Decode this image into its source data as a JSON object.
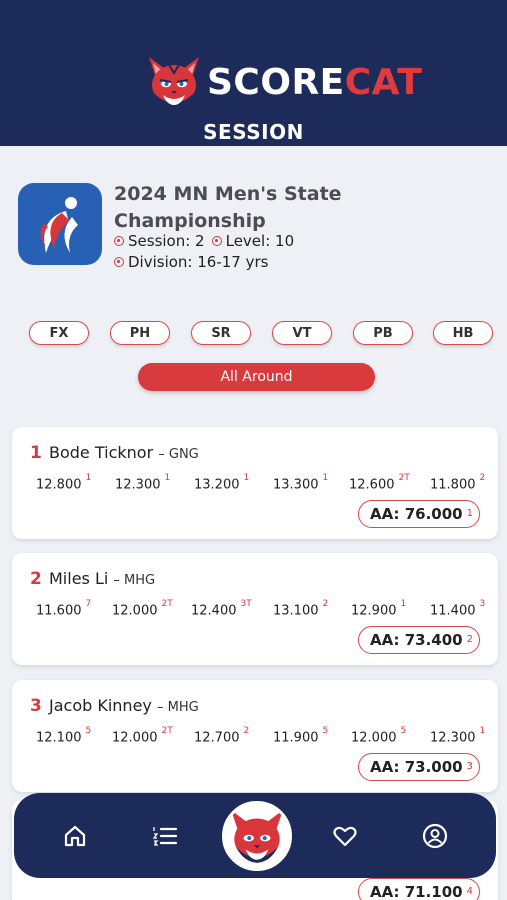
{
  "header": {
    "logo_text_white": "SCORE",
    "logo_text_red": "CAT",
    "title": "SESSION",
    "logo_icon": "cat-mascot-icon"
  },
  "meet": {
    "name": "2024 MN Men's State Championship",
    "session": "Session: 2",
    "level": "Level: 10",
    "division": "Division: 16-17 yrs",
    "logo_icon": "gymnastics-federation-logo"
  },
  "events": [
    "FX",
    "PH",
    "SR",
    "VT",
    "PB",
    "HB"
  ],
  "all_around_label": "All Around",
  "colors": {
    "navy": "#1d2b5a",
    "red": "#d93a3e",
    "background": "#eef0f5"
  },
  "results": [
    {
      "rank": "1",
      "name": "Bode Ticknor",
      "club": "– GNG",
      "scores": [
        {
          "score": "12.800",
          "place": "1"
        },
        {
          "score": "12.300",
          "place": "1"
        },
        {
          "score": "13.200",
          "place": "1"
        },
        {
          "score": "13.300",
          "place": "1"
        },
        {
          "score": "12.600",
          "place": "2T"
        },
        {
          "score": "11.800",
          "place": "2"
        }
      ],
      "aa": "AA: 76.000",
      "aa_place": "1"
    },
    {
      "rank": "2",
      "name": "Miles Li",
      "club": "– MHG",
      "scores": [
        {
          "score": "11.600",
          "place": "7"
        },
        {
          "score": "12.000",
          "place": "2T"
        },
        {
          "score": "12.400",
          "place": "3T"
        },
        {
          "score": "13.100",
          "place": "2"
        },
        {
          "score": "12.900",
          "place": "1"
        },
        {
          "score": "11.400",
          "place": "3"
        }
      ],
      "aa": "AA: 73.400",
      "aa_place": "2"
    },
    {
      "rank": "3",
      "name": "Jacob Kinney",
      "club": "– MHG",
      "scores": [
        {
          "score": "12.100",
          "place": "5"
        },
        {
          "score": "12.000",
          "place": "2T"
        },
        {
          "score": "12.700",
          "place": "2"
        },
        {
          "score": "11.900",
          "place": "5"
        },
        {
          "score": "12.000",
          "place": "5"
        },
        {
          "score": "12.300",
          "place": "1"
        }
      ],
      "aa": "AA: 73.000",
      "aa_place": "3"
    },
    {
      "aa": "AA: 71.100",
      "aa_place": "4"
    }
  ],
  "nav": {
    "items": [
      "home-icon",
      "list-icon",
      "cat-mascot-icon",
      "heart-icon",
      "profile-icon"
    ]
  }
}
